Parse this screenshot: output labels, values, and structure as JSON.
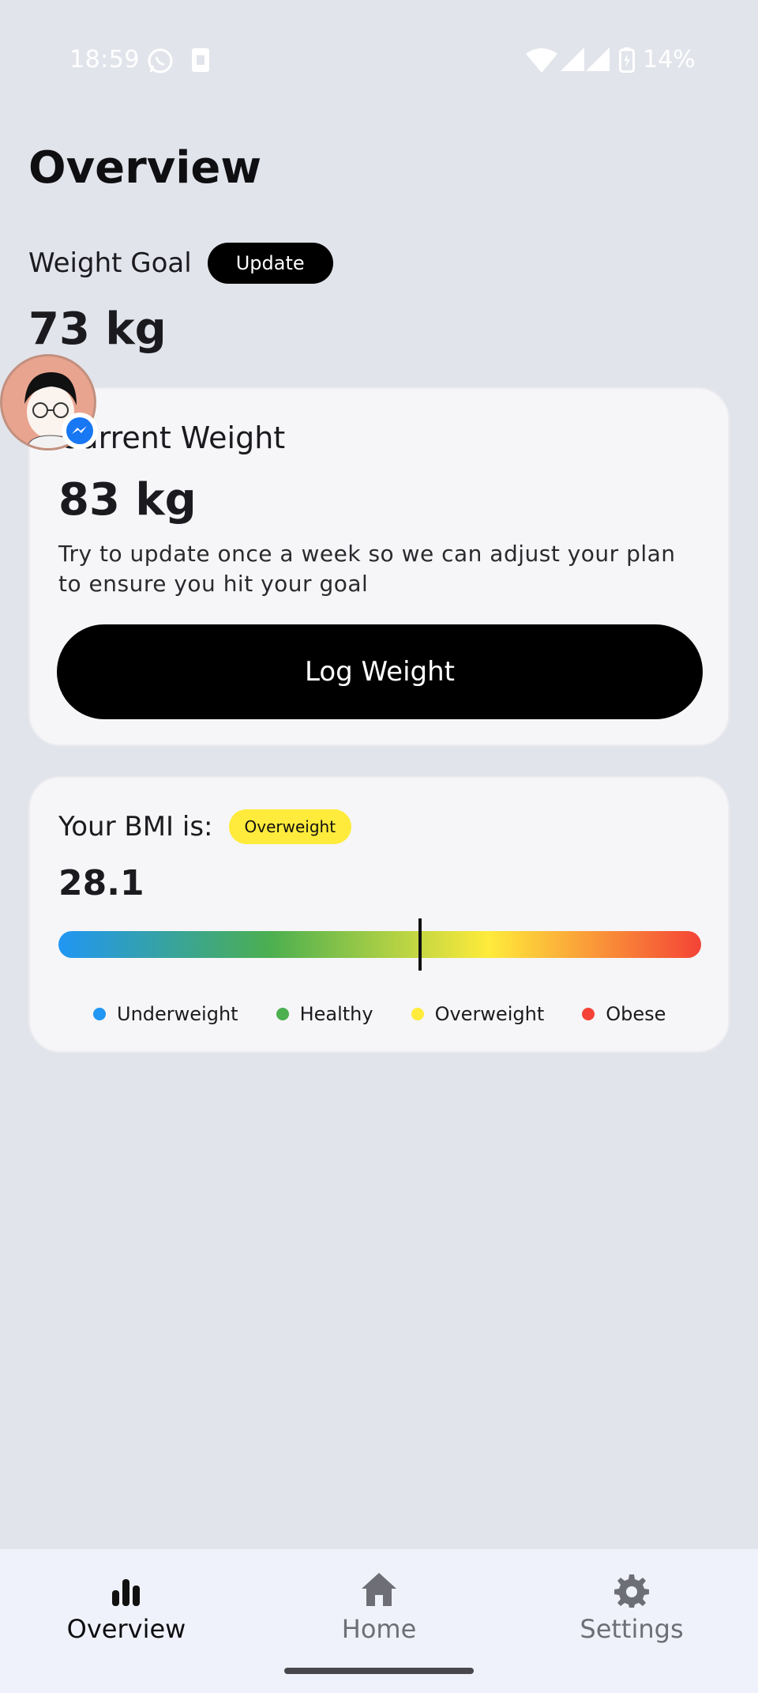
{
  "status_bar": {
    "time": "18:59",
    "battery": "14%",
    "icons": [
      "whatsapp-icon",
      "sim-icon",
      "wifi-icon",
      "signal-icon",
      "signal-icon",
      "battery-charging-icon"
    ]
  },
  "page": {
    "title": "Overview"
  },
  "goal": {
    "label": "Weight Goal",
    "update_label": "Update",
    "value": "73 kg"
  },
  "current_weight": {
    "title": "Current Weight",
    "value": "83 kg",
    "hint": "Try to update once a week so we can adjust your plan to ensure you hit your goal",
    "button_label": "Log Weight"
  },
  "bmi": {
    "label": "Your BMI is:",
    "category": "Overweight",
    "value": "28.1",
    "marker_fraction": 0.56,
    "legend": [
      {
        "label": "Underweight",
        "color": "#2196f3"
      },
      {
        "label": "Healthy",
        "color": "#4caf50"
      },
      {
        "label": "Overweight",
        "color": "#ffeb3b"
      },
      {
        "label": "Obese",
        "color": "#f44336"
      }
    ]
  },
  "nav": {
    "items": [
      {
        "label": "Overview",
        "icon": "bar-chart-icon",
        "active": true
      },
      {
        "label": "Home",
        "icon": "home-icon",
        "active": false
      },
      {
        "label": "Settings",
        "icon": "gear-icon",
        "active": false
      }
    ]
  },
  "colors": {
    "accent": "#000000",
    "background": "#e2e4eb",
    "card": "#f6f6f8",
    "badge": "#ffeb3b"
  }
}
